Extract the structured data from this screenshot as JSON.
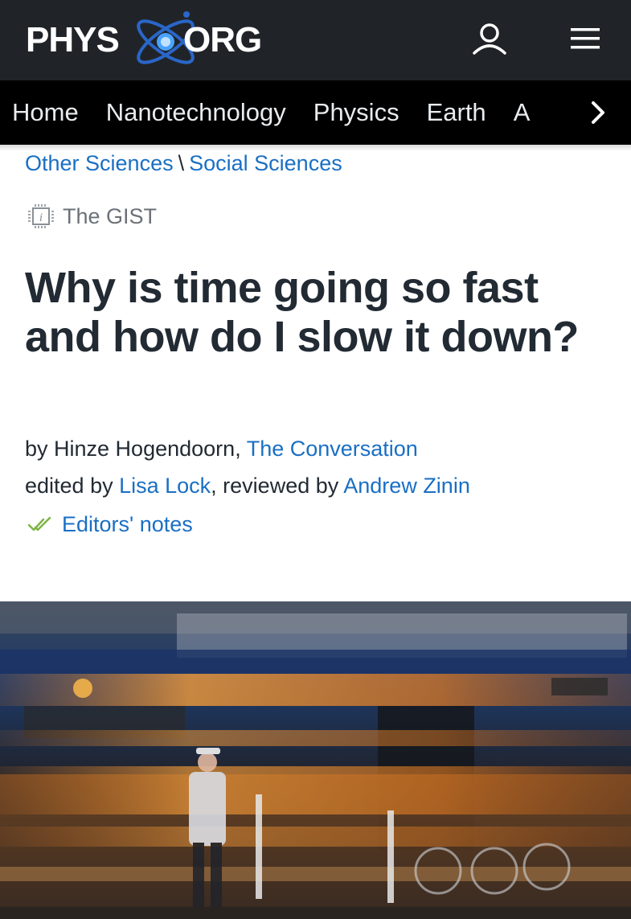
{
  "header": {
    "logo": {
      "left": "PHYS",
      "right": "ORG"
    },
    "icons": {
      "user": "user-icon",
      "menu": "hamburger-menu-icon"
    }
  },
  "nav": {
    "items": [
      "Home",
      "Nanotechnology",
      "Physics",
      "Earth",
      "A"
    ],
    "next_icon": "chevron-right-icon"
  },
  "breadcrumb": {
    "items": [
      "Other Sciences",
      "Social Sciences"
    ],
    "separator": "\\"
  },
  "gist": {
    "label": "The GIST",
    "icon": "gist-chip-icon"
  },
  "article": {
    "title": "Why is time going so fast and how do I slow it down?",
    "byline": {
      "by_prefix": "by ",
      "author": "Hinze Hogendoorn",
      "comma": ", ",
      "source": "The Conversation"
    },
    "edits": {
      "edited_prefix": "edited by ",
      "editor": "Lisa Lock",
      "reviewed_prefix": ", reviewed by ",
      "reviewer": "Andrew Zinin"
    },
    "editors_notes": {
      "label": "Editors' notes",
      "icon": "double-check-icon"
    }
  },
  "image": {
    "icon": "article-photo",
    "colors": {
      "orange": "#e07a22",
      "dark": "#1a1c22",
      "blue": "#1d3a6a"
    }
  },
  "colors": {
    "topbar": "#202428",
    "navbar": "#000000",
    "link": "#1a6fc4",
    "text": "#222a33",
    "muted": "#6b7177",
    "check": "#7cb342"
  }
}
